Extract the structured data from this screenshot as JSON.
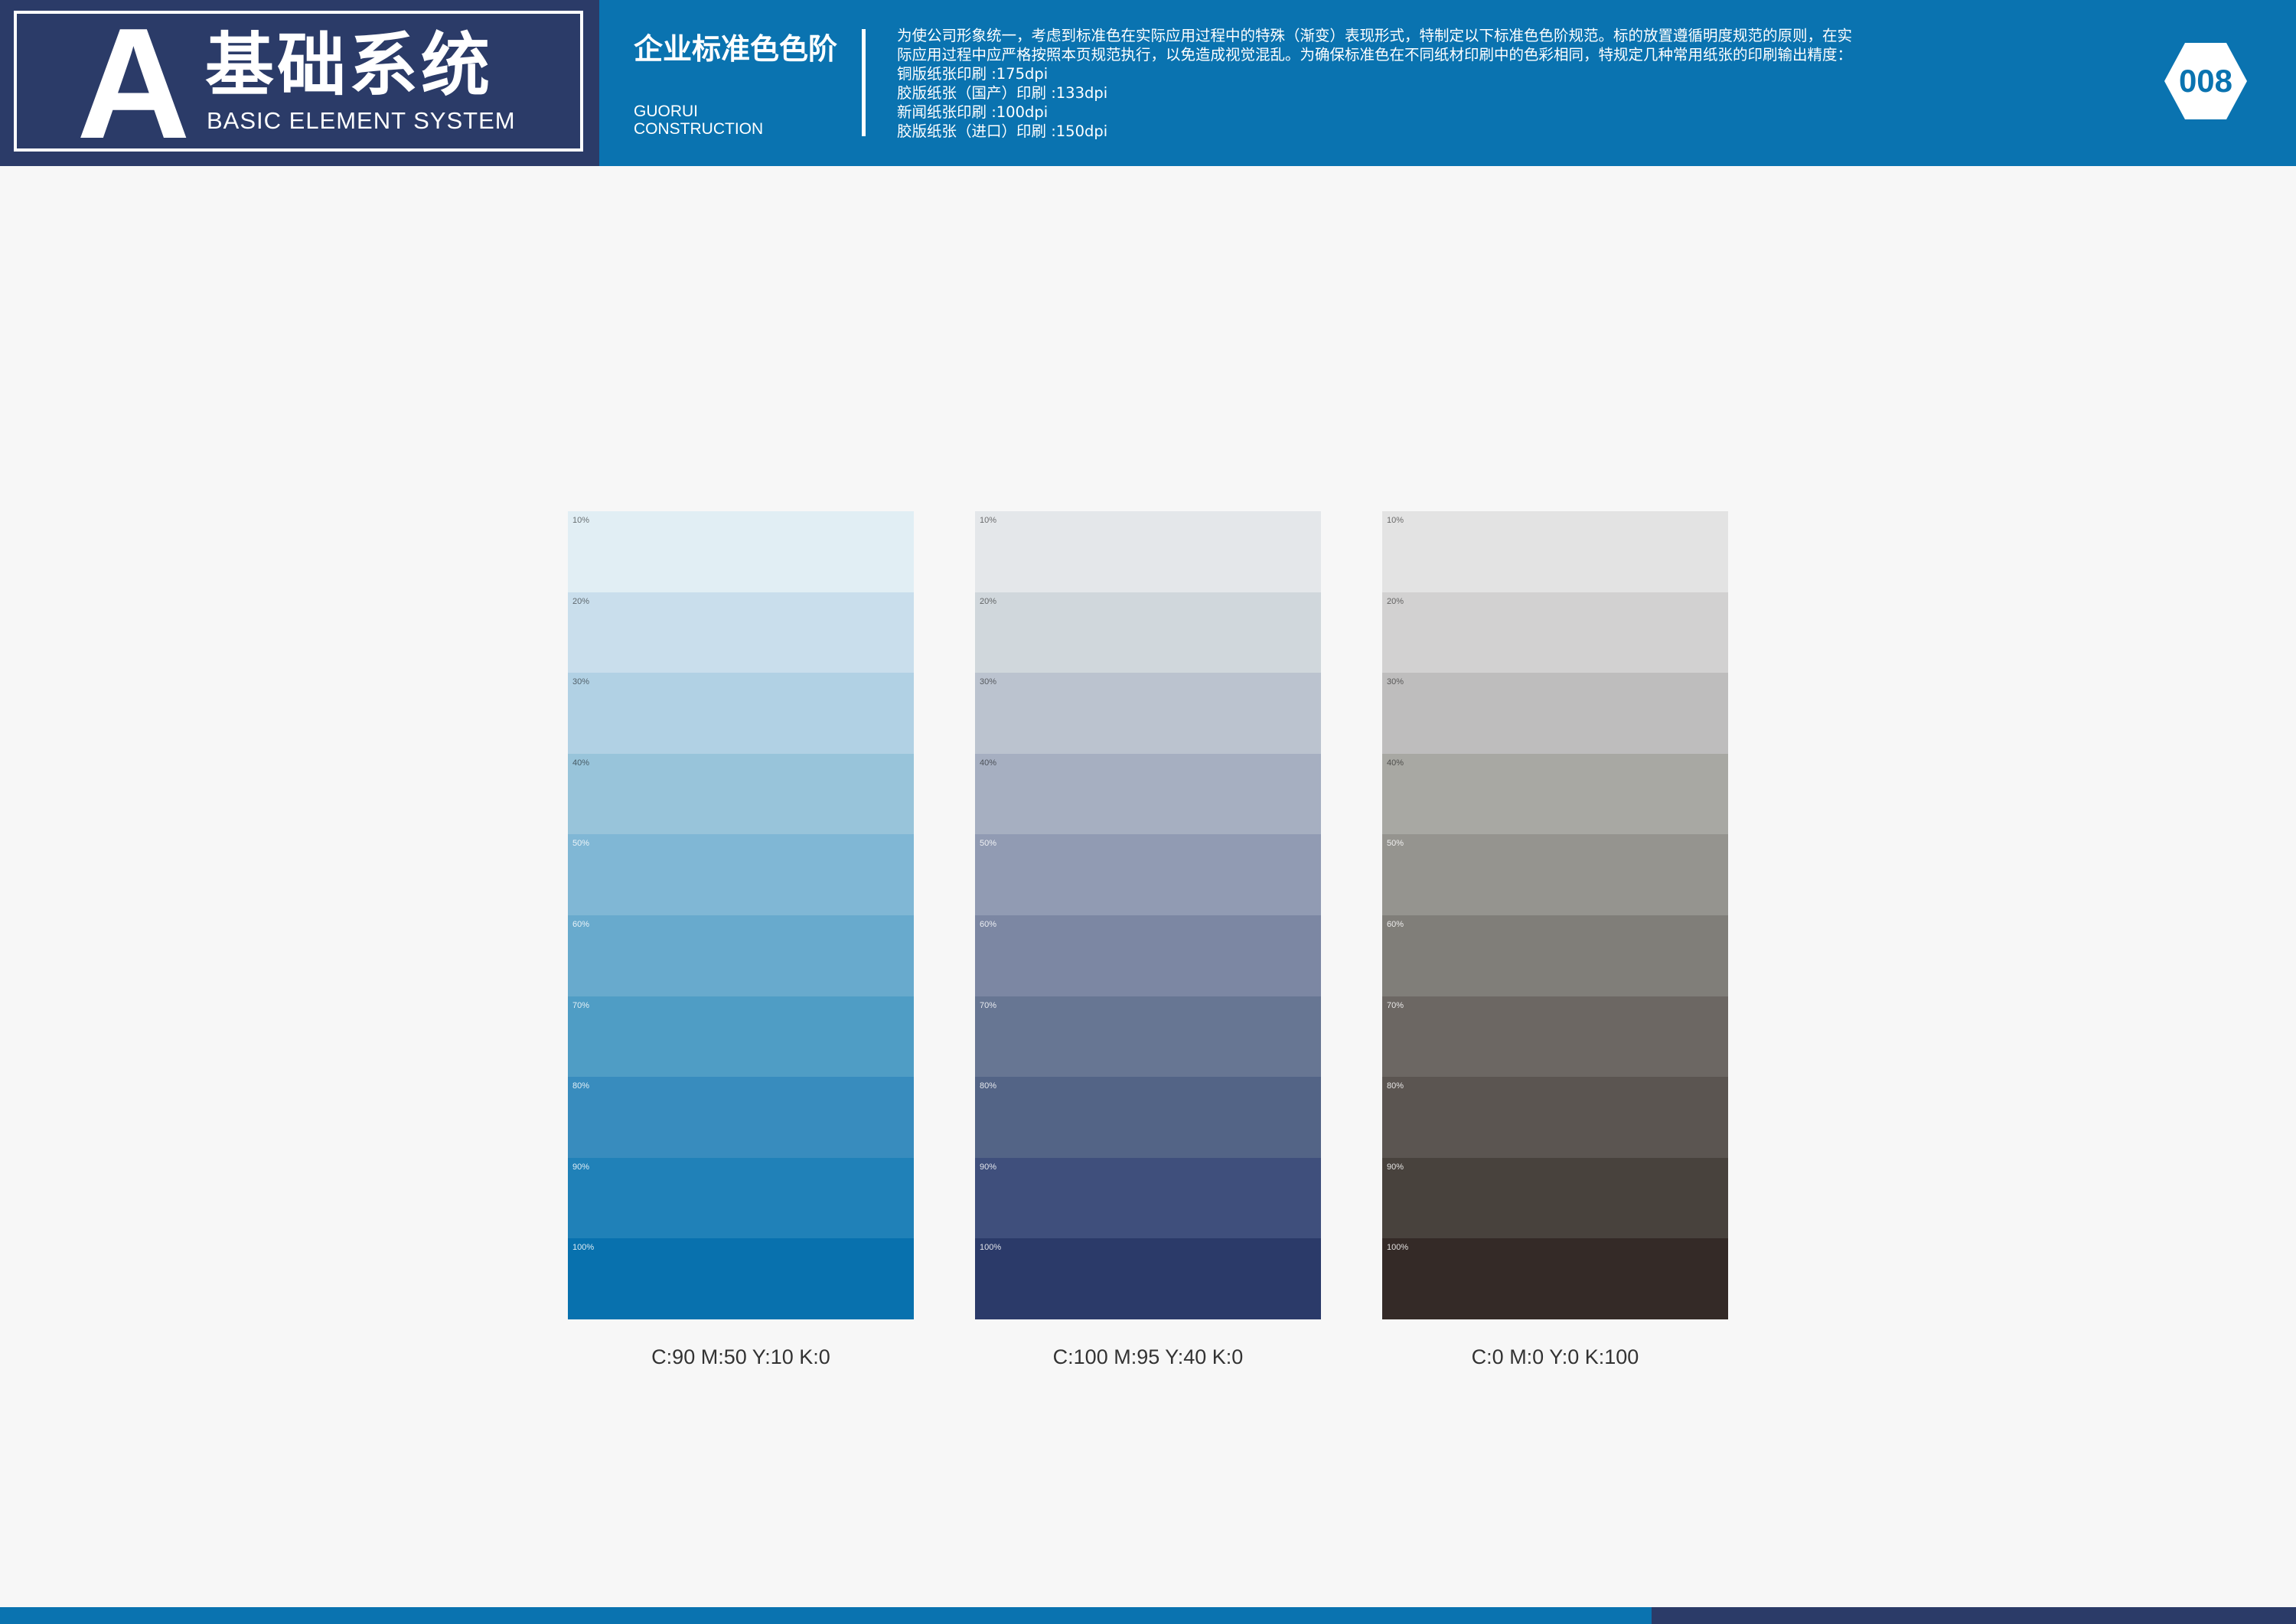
{
  "header": {
    "big_letter": "A",
    "system_title": "基础系统",
    "system_subtitle": "BASIC ELEMENT SYSTEM",
    "section_title": "企业标准色色阶",
    "company_en_line1": "GUORUI",
    "company_en_line2": "CONSTRUCTION",
    "description": "为使公司形象统一，考虑到标准色在实际应用过程中的特殊（渐变）表现形式，特制定以下标准色色阶规范。标的放置遵循明度规范的原则，在实际应用过程中应严格按照本页规范执行，以免造成视觉混乱。为确保标准色在不同纸材印刷中的色彩相同，特规定几种常用纸张的印刷输出精度：",
    "print_specs": [
      "铜版纸张印刷 :175dpi",
      "胶版纸张（国产）印刷 :133dpi",
      "新闻纸张印刷 :100dpi",
      "胶版纸张（进口）印刷 :150dpi"
    ],
    "page_number": "008"
  },
  "palettes": [
    {
      "caption": "C:90 M:50 Y:10 K:0",
      "steps": [
        {
          "label": "10%",
          "color": "#e1eef4"
        },
        {
          "label": "20%",
          "color": "#c9deec"
        },
        {
          "label": "30%",
          "color": "#b1d1e4"
        },
        {
          "label": "40%",
          "color": "#98c4da"
        },
        {
          "label": "50%",
          "color": "#80b7d5"
        },
        {
          "label": "60%",
          "color": "#68aacd"
        },
        {
          "label": "70%",
          "color": "#4f9dc5"
        },
        {
          "label": "80%",
          "color": "#388cbe"
        },
        {
          "label": "90%",
          "color": "#2081b8"
        },
        {
          "label": "100%",
          "color": "#0871ae"
        }
      ]
    },
    {
      "caption": "C:100 M:95 Y:40 K:0",
      "steps": [
        {
          "label": "10%",
          "color": "#e4e7ea"
        },
        {
          "label": "20%",
          "color": "#d0d7dc"
        },
        {
          "label": "30%",
          "color": "#bbc3cf"
        },
        {
          "label": "40%",
          "color": "#a6afc1"
        },
        {
          "label": "50%",
          "color": "#919bb3"
        },
        {
          "label": "60%",
          "color": "#7c87a3"
        },
        {
          "label": "70%",
          "color": "#677693"
        },
        {
          "label": "80%",
          "color": "#536486"
        },
        {
          "label": "90%",
          "color": "#3f4f7c"
        },
        {
          "label": "100%",
          "color": "#2b3a69"
        }
      ]
    },
    {
      "caption": "C:0 M:0 Y:0 K:100",
      "steps": [
        {
          "label": "10%",
          "color": "#e3e3e3"
        },
        {
          "label": "20%",
          "color": "#d2d1d1"
        },
        {
          "label": "30%",
          "color": "#bebdbd"
        },
        {
          "label": "40%",
          "color": "#a8a8a3"
        },
        {
          "label": "50%",
          "color": "#95948f"
        },
        {
          "label": "60%",
          "color": "#807e79"
        },
        {
          "label": "70%",
          "color": "#6c6763"
        },
        {
          "label": "80%",
          "color": "#5b5551"
        },
        {
          "label": "90%",
          "color": "#48423d"
        },
        {
          "label": "100%",
          "color": "#342a27"
        }
      ]
    }
  ],
  "colors": {
    "brand_blue": "#0a73b0",
    "brand_navy": "#2b3b68",
    "page_background": "#f7f7f7"
  }
}
